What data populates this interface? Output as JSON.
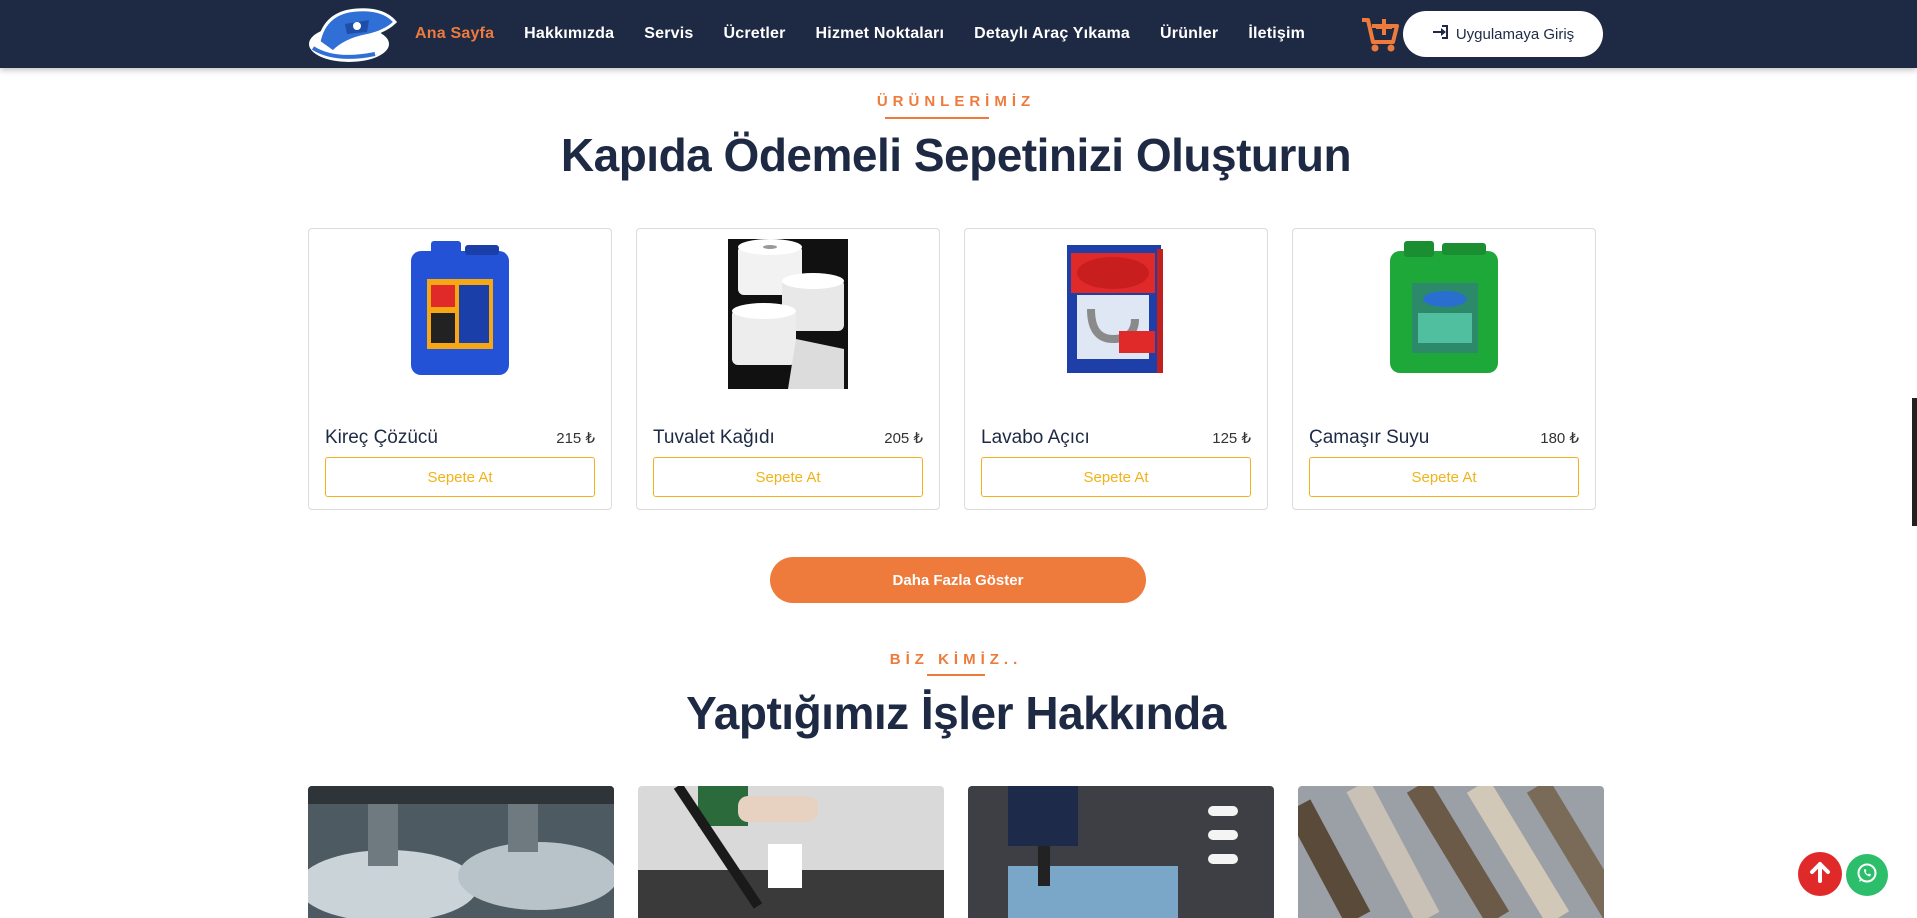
{
  "nav": {
    "links": [
      {
        "label": "Ana Sayfa",
        "active": true
      },
      {
        "label": "Hakkımızda"
      },
      {
        "label": "Servis"
      },
      {
        "label": "Ücretler"
      },
      {
        "label": "Hizmet Noktaları"
      },
      {
        "label": "Detaylı Araç Yıkama"
      },
      {
        "label": "Ürünler"
      },
      {
        "label": "İletişim"
      }
    ],
    "login_label": "Uygulamaya Giriş",
    "cart_icon": "cart-plus-icon",
    "login_icon": "sign-in-icon"
  },
  "products_section": {
    "eyebrow": "ÜRÜNLERİMİZ",
    "title": "Kapıda Ödemeli Sepetinizi Oluşturun",
    "items": [
      {
        "name": "Kireç Çözücü",
        "price": "215 ₺",
        "button": "Sepete At"
      },
      {
        "name": "Tuvalet Kağıdı",
        "price": "205 ₺",
        "button": "Sepete At"
      },
      {
        "name": "Lavabo Açıcı",
        "price": "125 ₺",
        "button": "Sepete At"
      },
      {
        "name": "Çamaşır Suyu",
        "price": "180 ₺",
        "button": "Sepete At"
      }
    ],
    "more_button": "Daha Fazla Göster"
  },
  "about_section": {
    "eyebrow": "BİZ KİMİZ..",
    "title": "Yaptığımız İşler Hakkında"
  },
  "colors": {
    "navy": "#1e2a44",
    "accent": "#ee7a3b",
    "button_outline": "#f2b21a",
    "scroll_top": "#e02a2a",
    "whatsapp": "#2dbe6c"
  }
}
